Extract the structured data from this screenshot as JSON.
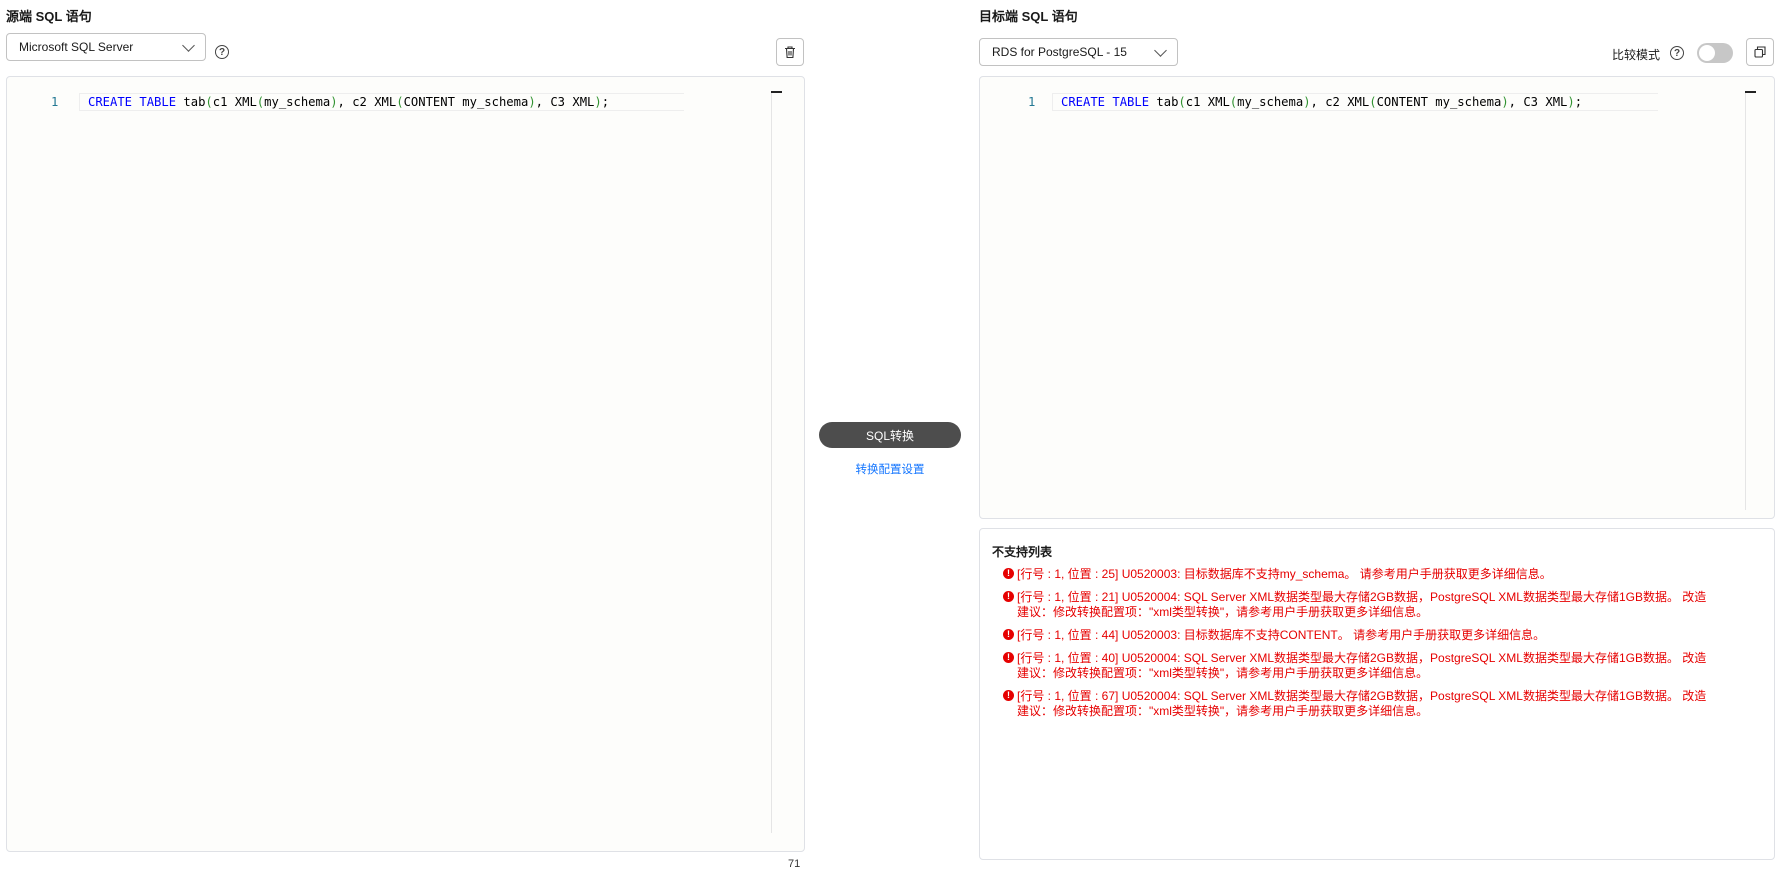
{
  "source": {
    "title": "源端 SQL 语句",
    "db_select": "Microsoft SQL Server",
    "help": "?",
    "line_number": "1",
    "char_count": "71"
  },
  "target": {
    "title": "目标端 SQL 语句",
    "db_select": "RDS for PostgreSQL - 15",
    "compare_mode_label": "比较模式",
    "help": "?",
    "line_number": "1"
  },
  "code": {
    "t1": "CREATE",
    "t2": "TABLE",
    "t3": "tab",
    "t4": "(",
    "t5": "c1 XML",
    "t6": "(",
    "t7": "my_schema",
    "t8": ")",
    "t9": ", c2 XML",
    "t10": "(",
    "t11": "CONTENT my_schema",
    "t12": ")",
    "t13": ", C3 XML",
    "t14": ")",
    "t15": ";"
  },
  "center": {
    "convert_button": "SQL转换",
    "config_link": "转换配置设置"
  },
  "unsupported": {
    "title": "不支持列表",
    "items": [
      "[行号 : 1, 位置 : 25] U0520003: 目标数据库不支持my_schema。 请参考用户手册获取更多详细信息。",
      "[行号 : 1, 位置 : 21] U0520004: SQL Server XML数据类型最大存储2GB数据，PostgreSQL XML数据类型最大存储1GB数据。 改造建议：修改转换配置项：\"xml类型转换\"，请参考用户手册获取更多详细信息。",
      "[行号 : 1, 位置 : 44] U0520003: 目标数据库不支持CONTENT。 请参考用户手册获取更多详细信息。",
      "[行号 : 1, 位置 : 40] U0520004: SQL Server XML数据类型最大存储2GB数据，PostgreSQL XML数据类型最大存储1GB数据。 改造建议：修改转换配置项：\"xml类型转换\"，请参考用户手册获取更多详细信息。",
      "[行号 : 1, 位置 : 67] U0520004: SQL Server XML数据类型最大存储2GB数据，PostgreSQL XML数据类型最大存储1GB数据。 改造建议：修改转换配置项：\"xml类型转换\"，请参考用户手册获取更多详细信息。"
    ]
  },
  "colors": {
    "keyword": "#0000ff",
    "bracket": "#319331",
    "error": "#e60000",
    "link": "#1476ff",
    "button": "#4d4d4d"
  }
}
